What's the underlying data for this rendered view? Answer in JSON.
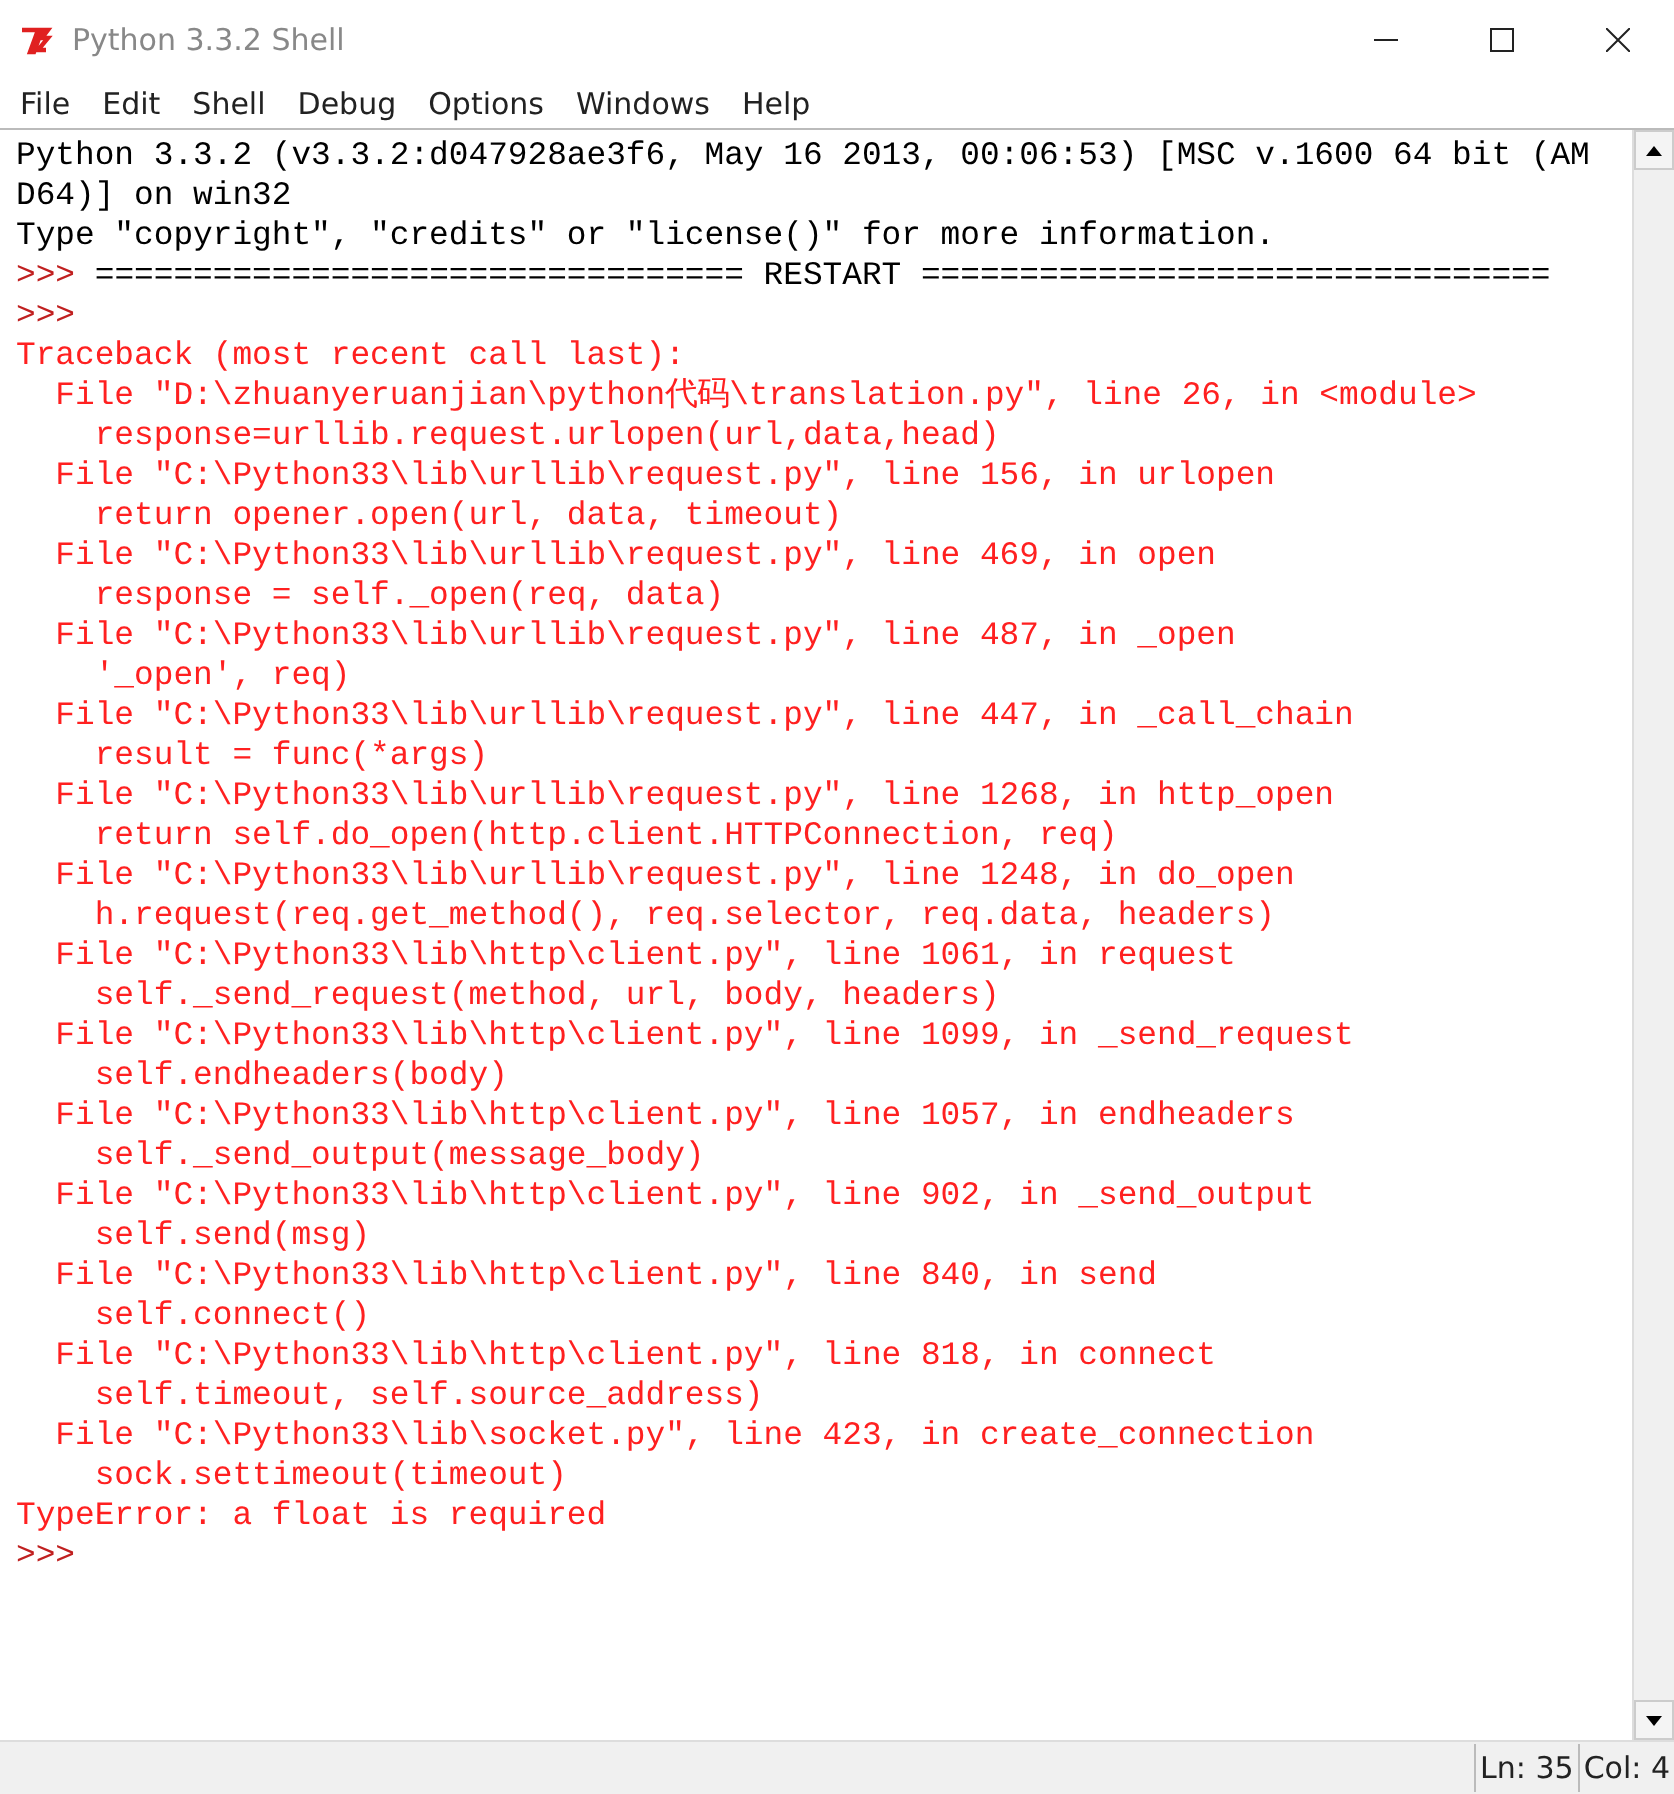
{
  "window": {
    "title": "Python 3.3.2 Shell"
  },
  "menu": [
    "File",
    "Edit",
    "Shell",
    "Debug",
    "Options",
    "Windows",
    "Help"
  ],
  "lines": [
    {
      "kind": "output",
      "text": "Python 3.3.2 (v3.3.2:d047928ae3f6, May 16 2013, 00:06:53) [MSC v.1600 64 bit (AM"
    },
    {
      "kind": "output",
      "text": "D64)] on win32"
    },
    {
      "kind": "output",
      "text": "Type \"copyright\", \"credits\" or \"license()\" for more information."
    },
    {
      "kind": "prompt",
      "prompt": ">>>",
      "text": "================================= RESTART ================================"
    },
    {
      "kind": "prompt",
      "prompt": ">>>"
    },
    {
      "kind": "error",
      "text": "Traceback (most recent call last):"
    },
    {
      "kind": "error",
      "text": "  File \"D:\\zhuanyeruanjian\\python代码\\translation.py\", line 26, in <module>"
    },
    {
      "kind": "error",
      "text": "    response=urllib.request.urlopen(url,data,head)"
    },
    {
      "kind": "error",
      "text": "  File \"C:\\Python33\\lib\\urllib\\request.py\", line 156, in urlopen"
    },
    {
      "kind": "error",
      "text": "    return opener.open(url, data, timeout)"
    },
    {
      "kind": "error",
      "text": "  File \"C:\\Python33\\lib\\urllib\\request.py\", line 469, in open"
    },
    {
      "kind": "error",
      "text": "    response = self._open(req, data)"
    },
    {
      "kind": "error",
      "text": "  File \"C:\\Python33\\lib\\urllib\\request.py\", line 487, in _open"
    },
    {
      "kind": "error",
      "text": "    '_open', req)"
    },
    {
      "kind": "error",
      "text": "  File \"C:\\Python33\\lib\\urllib\\request.py\", line 447, in _call_chain"
    },
    {
      "kind": "error",
      "text": "    result = func(*args)"
    },
    {
      "kind": "error",
      "text": "  File \"C:\\Python33\\lib\\urllib\\request.py\", line 1268, in http_open"
    },
    {
      "kind": "error",
      "text": "    return self.do_open(http.client.HTTPConnection, req)"
    },
    {
      "kind": "error",
      "text": "  File \"C:\\Python33\\lib\\urllib\\request.py\", line 1248, in do_open"
    },
    {
      "kind": "error",
      "text": "    h.request(req.get_method(), req.selector, req.data, headers)"
    },
    {
      "kind": "error",
      "text": "  File \"C:\\Python33\\lib\\http\\client.py\", line 1061, in request"
    },
    {
      "kind": "error",
      "text": "    self._send_request(method, url, body, headers)"
    },
    {
      "kind": "error",
      "text": "  File \"C:\\Python33\\lib\\http\\client.py\", line 1099, in _send_request"
    },
    {
      "kind": "error",
      "text": "    self.endheaders(body)"
    },
    {
      "kind": "error",
      "text": "  File \"C:\\Python33\\lib\\http\\client.py\", line 1057, in endheaders"
    },
    {
      "kind": "error",
      "text": "    self._send_output(message_body)"
    },
    {
      "kind": "error",
      "text": "  File \"C:\\Python33\\lib\\http\\client.py\", line 902, in _send_output"
    },
    {
      "kind": "error",
      "text": "    self.send(msg)"
    },
    {
      "kind": "error",
      "text": "  File \"C:\\Python33\\lib\\http\\client.py\", line 840, in send"
    },
    {
      "kind": "error",
      "text": "    self.connect()"
    },
    {
      "kind": "error",
      "text": "  File \"C:\\Python33\\lib\\http\\client.py\", line 818, in connect"
    },
    {
      "kind": "error",
      "text": "    self.timeout, self.source_address)"
    },
    {
      "kind": "error",
      "text": "  File \"C:\\Python33\\lib\\socket.py\", line 423, in create_connection"
    },
    {
      "kind": "error",
      "text": "    sock.settimeout(timeout)"
    },
    {
      "kind": "error",
      "text": "TypeError: a float is required"
    },
    {
      "kind": "prompt",
      "prompt": ">>>"
    }
  ],
  "status_bar": {
    "line": "Ln: 35",
    "column": "Col: 4"
  }
}
